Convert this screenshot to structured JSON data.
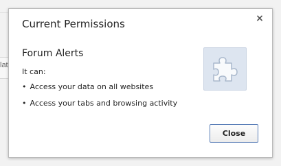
{
  "background": {
    "partial_label": "lat"
  },
  "dialog": {
    "title": "Current Permissions",
    "close_icon_glyph": "×",
    "extension_name": "Forum Alerts",
    "intro": "It can:",
    "permissions": [
      "Access your data on all websites",
      "Access your tabs and browsing activity"
    ],
    "icon": "puzzle-piece-icon",
    "close_button_label": "Close"
  },
  "colors": {
    "icon_bg": "#dde5f0",
    "button_border": "#5b7fb8"
  }
}
